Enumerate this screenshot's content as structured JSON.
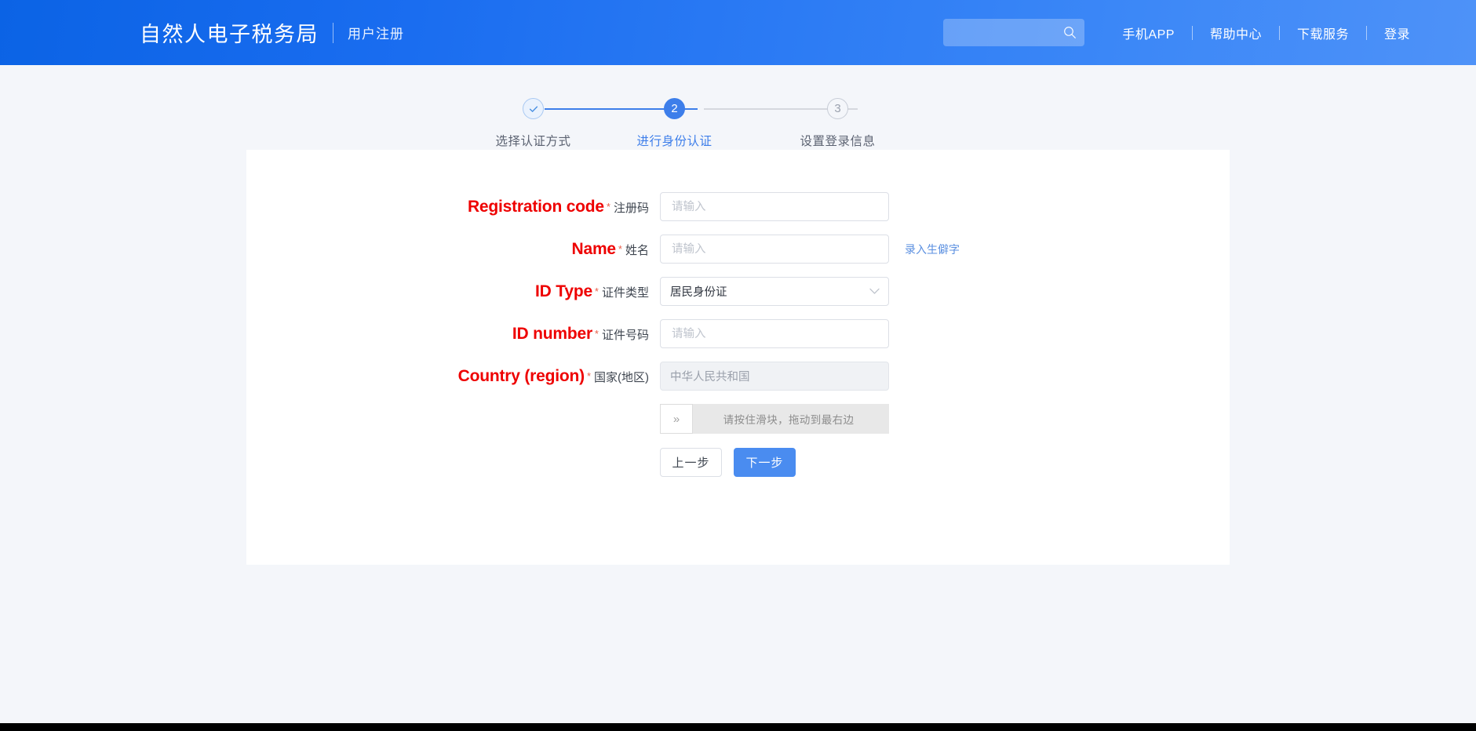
{
  "header": {
    "brand_title": "自然人电子税务局",
    "brand_sub": "用户注册",
    "search_placeholder": "",
    "search_value": "",
    "nav": [
      {
        "label": "手机APP"
      },
      {
        "label": "帮助中心"
      },
      {
        "label": "下载服务"
      },
      {
        "label": "登录"
      }
    ]
  },
  "steps": [
    {
      "number": "1",
      "label": "选择认证方式",
      "state": "done"
    },
    {
      "number": "2",
      "label": "进行身份认证",
      "state": "active"
    },
    {
      "number": "3",
      "label": "设置登录信息",
      "state": "todo"
    }
  ],
  "form": {
    "fields": [
      {
        "en_label": "Registration code",
        "required": "*",
        "cn_label": "注册码",
        "value": "",
        "placeholder": "请输入",
        "type": "text"
      },
      {
        "en_label": "Name",
        "required": "*",
        "cn_label": "姓名",
        "value": "",
        "placeholder": "请输入",
        "type": "text",
        "side_link": "录入生僻字"
      },
      {
        "en_label": "ID Type",
        "required": "*",
        "cn_label": "证件类型",
        "value": "居民身份证",
        "placeholder": "",
        "type": "select"
      },
      {
        "en_label": "ID number",
        "required": "*",
        "cn_label": "证件号码",
        "value": "",
        "placeholder": "请输入",
        "type": "text"
      },
      {
        "en_label": "Country (region)",
        "required": "*",
        "cn_label": "国家(地区)",
        "value": "中华人民共和国",
        "placeholder": "",
        "type": "disabled"
      }
    ],
    "captcha": {
      "handle_glyph": "»",
      "hint": "请按住滑块，拖动到最右边"
    },
    "buttons": {
      "prev": "上一步",
      "next": "下一步"
    }
  },
  "colors": {
    "brand_blue": "#1a6df0",
    "accent_blue": "#3d7eea",
    "annotation_red": "#ee0000",
    "page_bg": "#f4f6fa"
  }
}
